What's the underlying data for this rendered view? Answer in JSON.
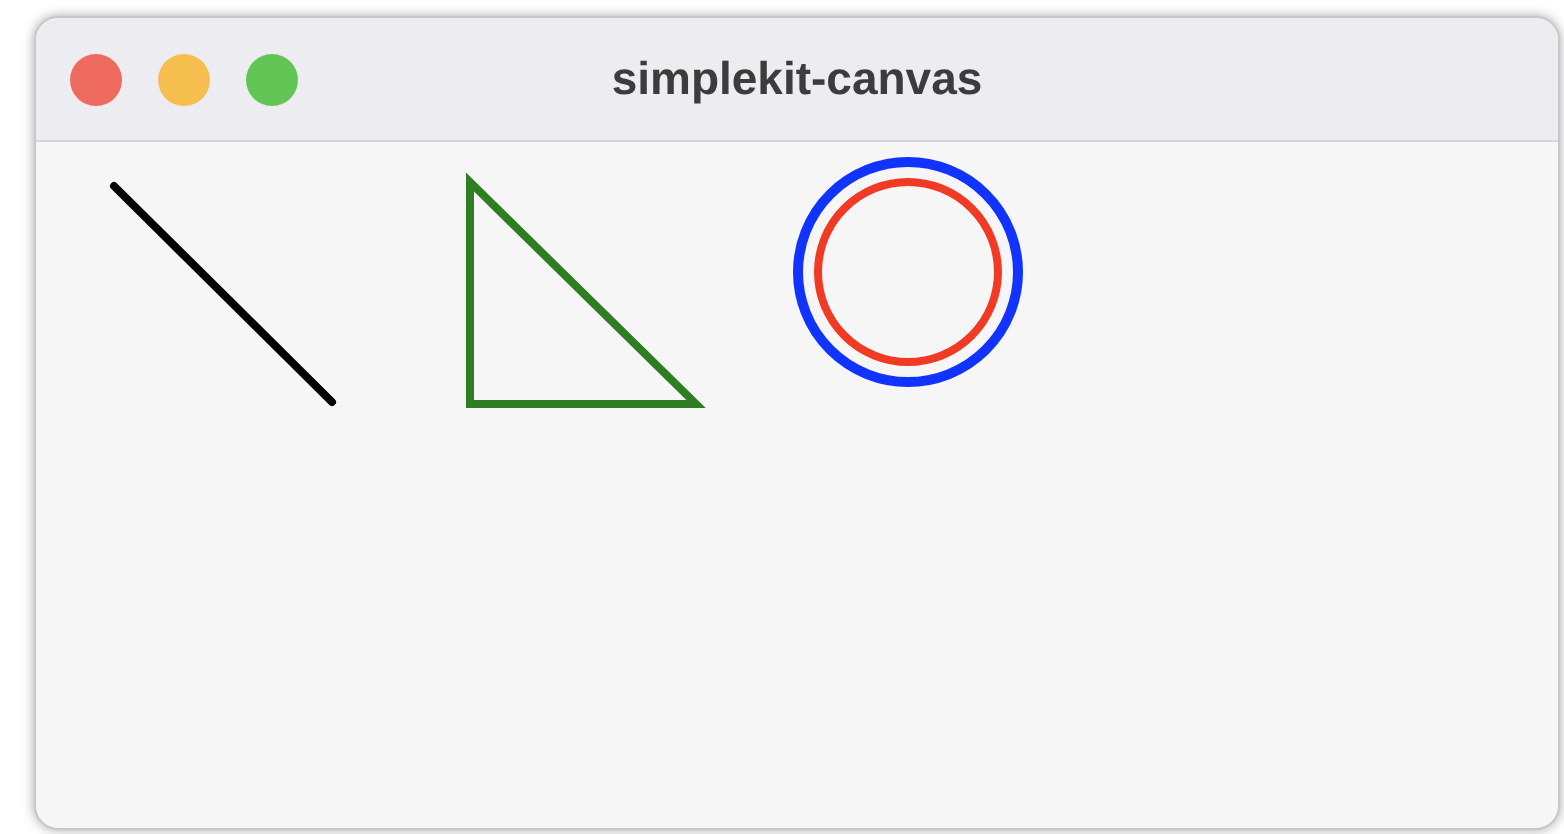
{
  "window": {
    "title": "simplekit-canvas"
  },
  "shapes": [
    {
      "kind": "line",
      "color": "#000000"
    },
    {
      "kind": "triangle",
      "color": "#2e7d23"
    },
    {
      "kind": "circle",
      "color": "#1133ff"
    },
    {
      "kind": "circle",
      "color": "#f03a24"
    }
  ]
}
